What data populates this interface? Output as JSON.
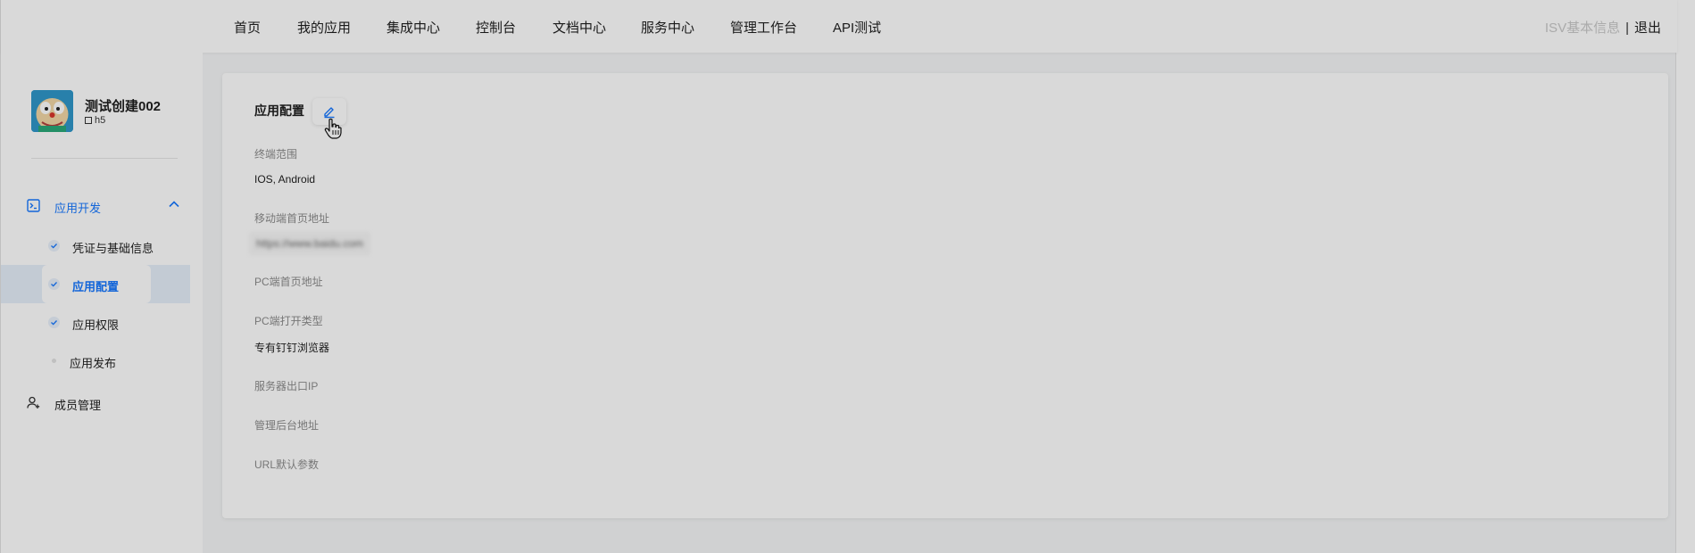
{
  "nav": {
    "items": [
      "首页",
      "我的应用",
      "集成中心",
      "控制台",
      "文档中心",
      "服务中心",
      "管理工作台",
      "API测试"
    ],
    "isv_info": "ISV基本信息",
    "separator": "|",
    "logout": "退出"
  },
  "app": {
    "name": "测试创建002",
    "type": "h5"
  },
  "sidebar": {
    "group_label": "应用开发",
    "sub_items": [
      {
        "label": "凭证与基础信息",
        "state": "done"
      },
      {
        "label": "应用配置",
        "state": "active"
      },
      {
        "label": "应用权限",
        "state": "done"
      },
      {
        "label": "应用发布",
        "state": "pending"
      }
    ],
    "member_label": "成员管理"
  },
  "card": {
    "title": "应用配置",
    "fields": [
      {
        "label": "终端范围",
        "value": "IOS, Android"
      },
      {
        "label": "移动端首页地址",
        "value": "https://www.baidu.com"
      },
      {
        "label": "PC端首页地址",
        "value": ""
      },
      {
        "label": "PC端打开类型",
        "value": "专有钉钉浏览器"
      },
      {
        "label": "服务器出口IP",
        "value": ""
      },
      {
        "label": "管理后台地址",
        "value": ""
      },
      {
        "label": "URL默认参数",
        "value": ""
      }
    ]
  },
  "colors": {
    "accent": "#1677ff",
    "active_bg": "#e6eff9",
    "page_bg": "#f5f6f7"
  }
}
